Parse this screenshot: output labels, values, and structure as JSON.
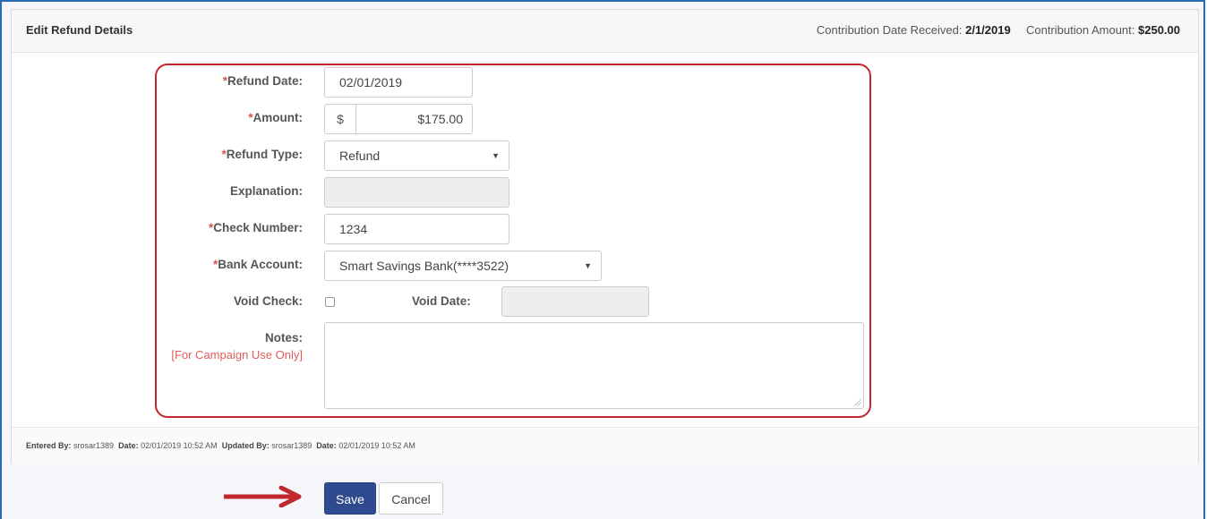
{
  "header": {
    "title": "Edit Refund Details",
    "date_received_label": "Contribution Date Received:",
    "date_received_value": "2/1/2019",
    "amount_label": "Contribution Amount:",
    "amount_value": "$250.00"
  },
  "form": {
    "required_mark": "*",
    "refund_date": {
      "label": "Refund Date:",
      "value": "02/01/2019"
    },
    "amount": {
      "label": "Amount:",
      "addon": "$",
      "value": "$175.00"
    },
    "refund_type": {
      "label": "Refund Type:",
      "value": "Refund"
    },
    "explanation": {
      "label": "Explanation:",
      "value": ""
    },
    "check_number": {
      "label": "Check Number:",
      "value": "1234"
    },
    "bank_account": {
      "label": "Bank Account:",
      "value": "Smart Savings Bank(****3522)"
    },
    "void_check": {
      "label": "Void Check:",
      "checked": false
    },
    "void_date": {
      "label": "Void Date:",
      "value": ""
    },
    "notes": {
      "label": "Notes:",
      "sublabel": "[For Campaign Use Only]",
      "value": ""
    }
  },
  "audit": {
    "entered_by_label": "Entered By:",
    "entered_by": "srosar1389",
    "date_label": "Date:",
    "entered_date": "02/01/2019 10:52 AM",
    "updated_by_label": "Updated By:",
    "updated_by": "srosar1389",
    "updated_date": "02/01/2019 10:52 AM"
  },
  "actions": {
    "save_label": "Save",
    "cancel_label": "Cancel"
  },
  "colors": {
    "highlight": "#c0282e",
    "primary": "#2f4a8f",
    "required": "#d9534f"
  }
}
